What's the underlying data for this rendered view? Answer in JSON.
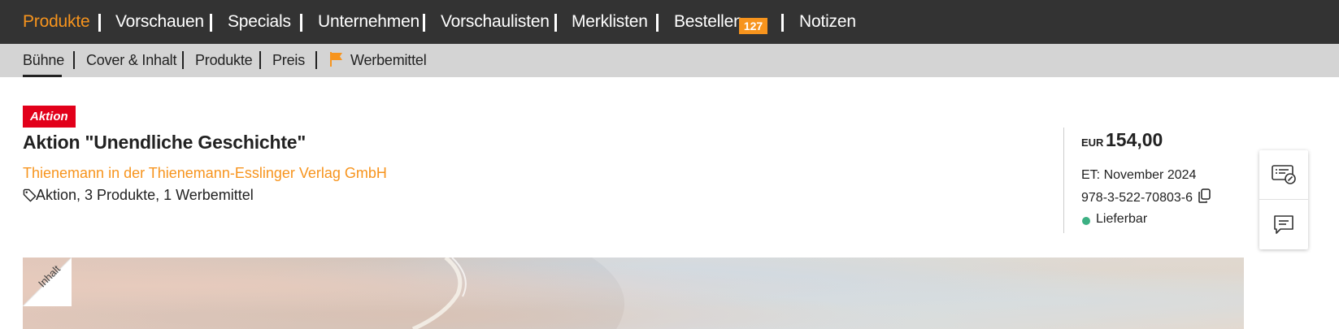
{
  "topnav": {
    "items": [
      {
        "label": "Produkte"
      },
      {
        "label": "Vorschauen"
      },
      {
        "label": "Specials"
      },
      {
        "label": "Unternehmen"
      },
      {
        "label": "Vorschaulisten"
      },
      {
        "label": "Merklisten"
      },
      {
        "label": "Bestellen"
      },
      {
        "label": "Notizen"
      }
    ],
    "active_index": 0,
    "bestellen_count": "127",
    "accent_color": "#f7941d"
  },
  "subnav": {
    "items": [
      {
        "label": "Bühne"
      },
      {
        "label": "Cover & Inhalt"
      },
      {
        "label": "Produkte"
      },
      {
        "label": "Preis"
      },
      {
        "label": "Werbemittel",
        "icon": "flag-icon"
      }
    ],
    "active_index": 0
  },
  "product": {
    "badge": "Aktion",
    "title": "Aktion \"Unendliche Geschichte\"",
    "publisher": "Thienemann in der Thienemann-Esslinger Verlag GmbH",
    "meta": "Aktion, 3 Produkte, 1 Werbemittel",
    "meta_icon": "tag-icon"
  },
  "info": {
    "currency": "EUR",
    "price": "154,00",
    "release": "ET: November 2024",
    "isbn": "978-3-522-70803-6",
    "status": "Lieferbar",
    "status_color": "#3cb083"
  },
  "sidepanel": {
    "buttons": [
      {
        "icon": "note-edit-icon"
      },
      {
        "icon": "comment-icon"
      }
    ]
  },
  "cover": {
    "corner_label": "Inhalt"
  }
}
